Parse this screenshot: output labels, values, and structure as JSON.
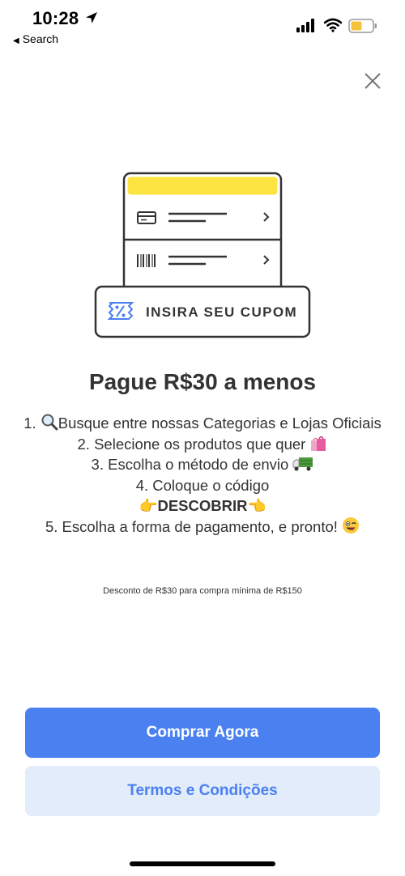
{
  "status_bar": {
    "time": "10:28",
    "back_label": "Search",
    "back_arrow": "◀"
  },
  "illustration": {
    "coupon_label": "INSIRA SEU CUPOM",
    "accent_color": "#fee440",
    "icon_color": "#4a80f0"
  },
  "title": "Pague R$30 a menos",
  "steps": {
    "step1": "1. ",
    "step1_text": "Busque entre nossas Categorias e Lojas Oficiais",
    "step2": "2. Selecione os produtos que quer ",
    "step3": "3. Escolha o método de envio ",
    "step4": "4. Coloque o código",
    "code": "DESCOBRIR",
    "step5": "5. Escolha a forma de pagamento, e pronto! "
  },
  "disclaimer": "Desconto de R$30 para compra mínima de R$150",
  "buttons": {
    "primary": "Comprar Agora",
    "secondary": "Termos e Condições"
  },
  "colors": {
    "primary": "#4a80f0",
    "secondary_bg": "#e3ecfb",
    "text": "#333333"
  }
}
